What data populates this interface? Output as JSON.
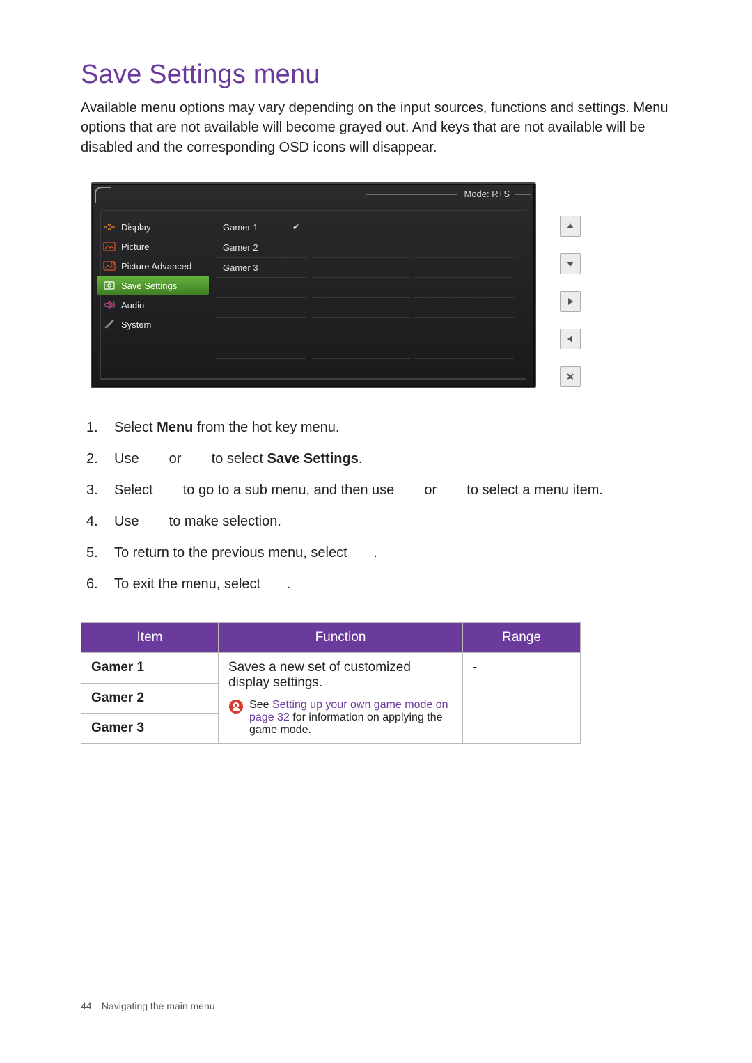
{
  "title": "Save Settings menu",
  "intro": "Available menu options may vary depending on the input sources, functions and settings. Menu options that are not available will become grayed out. And keys that are not available will be disabled and the corresponding OSD icons will disappear.",
  "osd": {
    "mode_label": "Mode: RTS",
    "menu": [
      {
        "id": "display",
        "label": "Display"
      },
      {
        "id": "picture",
        "label": "Picture"
      },
      {
        "id": "picture-advanced",
        "label": "Picture Advanced"
      },
      {
        "id": "save-settings",
        "label": "Save Settings",
        "selected": true
      },
      {
        "id": "audio",
        "label": "Audio"
      },
      {
        "id": "system",
        "label": "System"
      }
    ],
    "submenu": [
      {
        "label": "Gamer 1",
        "checked": true
      },
      {
        "label": "Gamer 2",
        "checked": false
      },
      {
        "label": "Gamer 3",
        "checked": false
      }
    ]
  },
  "steps": {
    "s1a": "Select ",
    "s1b": "Menu",
    "s1c": " from the hot key menu.",
    "s2a": "Use ",
    "s2b": " or ",
    "s2c": " to select ",
    "s2d": "Save Settings",
    "s2e": ".",
    "s3a": "Select ",
    "s3b": " to go to a sub menu, and then use ",
    "s3c": " or ",
    "s3d": " to select a menu item.",
    "s4a": "Use ",
    "s4b": " to make selection.",
    "s5a": "To return to the previous menu, select ",
    "s5b": ".",
    "s6a": "To exit the menu, select ",
    "s6b": "."
  },
  "table": {
    "headers": {
      "item": "Item",
      "function": "Function",
      "range": "Range"
    },
    "items": {
      "g1": "Gamer 1",
      "g2": "Gamer 2",
      "g3": "Gamer 3"
    },
    "function_main": "Saves a new set of customized display settings.",
    "range_value": "-",
    "note_prefix": "See ",
    "note_link": "Setting up your own game mode on page 32",
    "note_suffix": " for information on applying the game mode."
  },
  "footer": {
    "page_number": "44",
    "section": "Navigating the main menu"
  }
}
